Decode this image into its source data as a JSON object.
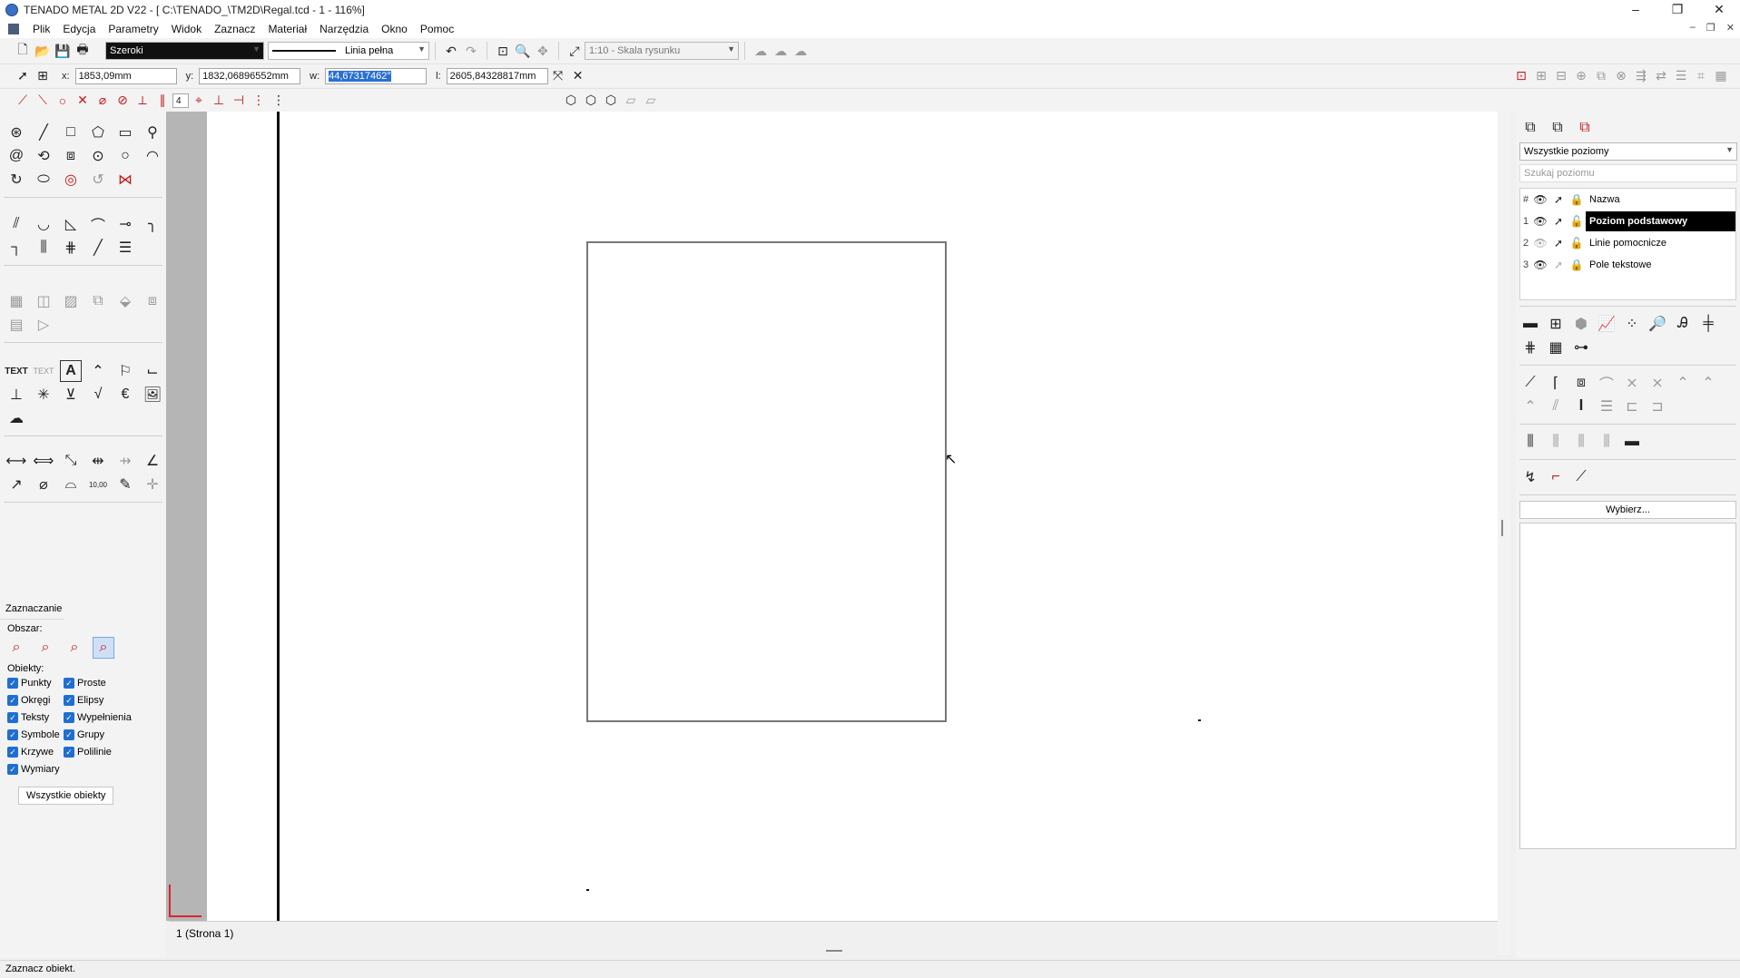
{
  "window": {
    "title": "TENADO METAL 2D V22 - [ C:\\TENADO_\\TM2D\\Regal.tcd - 1 - 116%]",
    "controls": [
      "–",
      "❐",
      "✕"
    ],
    "mdi_controls": [
      "–",
      "❐",
      "✕"
    ]
  },
  "menu": {
    "items": [
      "Plik",
      "Edycja",
      "Parametry",
      "Widok",
      "Zaznacz",
      "Materiał",
      "Narzędzia",
      "Okno",
      "Pomoc"
    ]
  },
  "toolbar": {
    "line_width": "Szeroki",
    "line_type": "Linia pełna",
    "scale": "1:10 - Skala rysunku"
  },
  "coords": {
    "x_label": "x:",
    "x_value": "1853,09mm",
    "y_label": "y:",
    "y_value": "1832,06896552mm",
    "w_label": "w:",
    "w_value": "44,67317462°",
    "l_label": "l:",
    "l_value": "2605,84328817mm"
  },
  "snap_toolbar": {
    "small_value": "4"
  },
  "left_panel": {
    "text_tool_1": "TEXT",
    "text_tool_2": "TEXT",
    "text_tool_3": "A",
    "dim_tool_value": "10,00",
    "selection": {
      "header": "Zaznaczanie",
      "area_label": "Obszar:",
      "objects_label": "Obiekty:",
      "checkboxes": [
        {
          "label": "Punkty",
          "checked": true
        },
        {
          "label": "Proste",
          "checked": true
        },
        {
          "label": "Okręgi",
          "checked": true
        },
        {
          "label": "Elipsy",
          "checked": true
        },
        {
          "label": "Teksty",
          "checked": true
        },
        {
          "label": "Wypełnienia",
          "checked": true
        },
        {
          "label": "Symbole",
          "checked": true
        },
        {
          "label": "Grupy",
          "checked": true
        },
        {
          "label": "Krzywe",
          "checked": true
        },
        {
          "label": "Polilinie",
          "checked": true
        },
        {
          "label": "Wymiary",
          "checked": true
        }
      ],
      "all_objects_button": "Wszystkie obiekty"
    }
  },
  "canvas": {
    "sheet_tab": "1 (Strona 1)"
  },
  "right_panel": {
    "levels_dropdown": "Wszystkie poziomy",
    "search_placeholder": "Szukaj poziomu",
    "layer_header": {
      "num": "#",
      "name": "Nazwa"
    },
    "layers": [
      {
        "num": "1",
        "name": "Poziom podstawowy",
        "selected": true
      },
      {
        "num": "2",
        "name": "Linie pomocnicze",
        "selected": false
      },
      {
        "num": "3",
        "name": "Pole tekstowe",
        "selected": false
      }
    ],
    "choose_button": "Wybierz..."
  },
  "status": {
    "text": "Zaznacz obiekt."
  },
  "colors": {
    "selection_blue": "#2a6fd3",
    "checkbox_blue": "#1f6fcf",
    "accent_red": "#c41a1a"
  }
}
